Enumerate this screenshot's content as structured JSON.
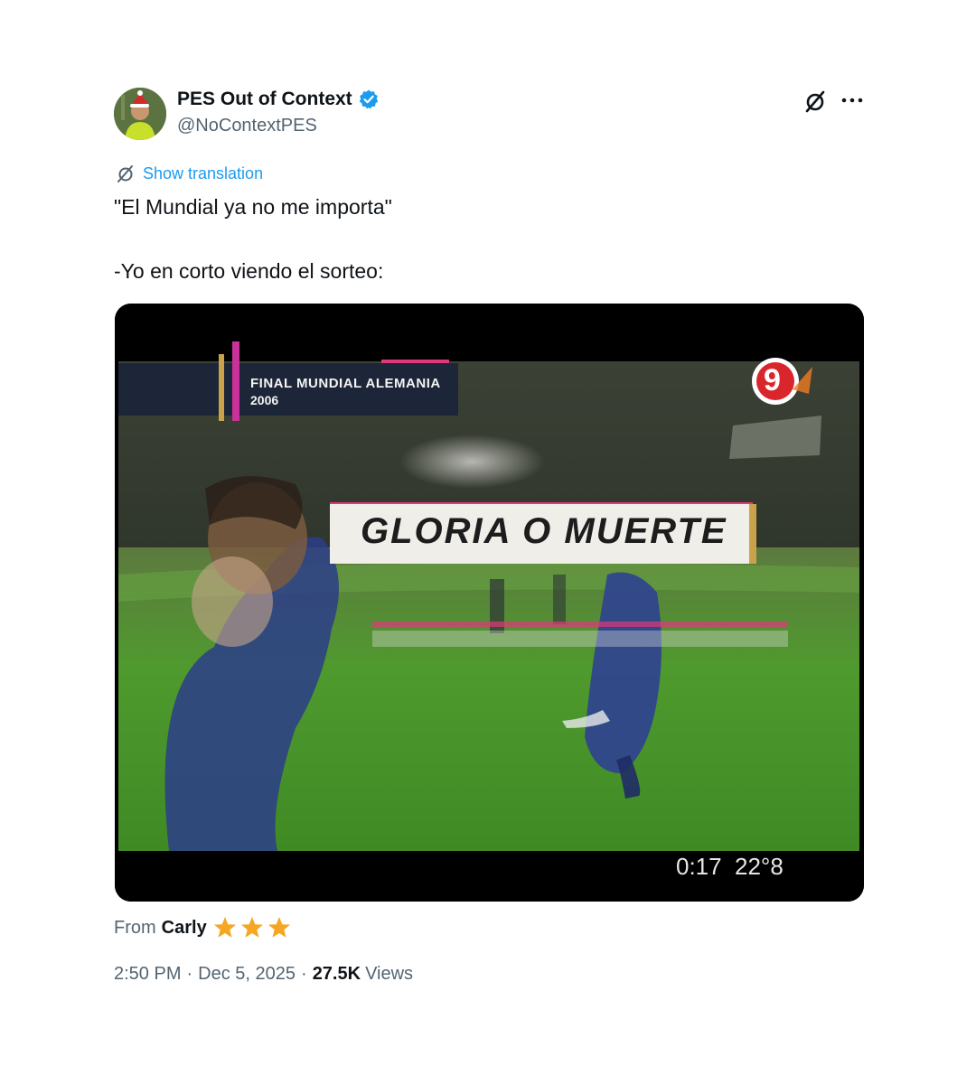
{
  "author": {
    "display_name": "PES Out of Context",
    "handle": "@NoContextPES",
    "verified_color": "#1d9bf0"
  },
  "header_icons": {
    "grok": "grok-icon",
    "more": "more-icon"
  },
  "translate": {
    "label": "Show translation",
    "color": "#1d9bf0"
  },
  "tweet": {
    "line1": "\"El Mundial ya no me importa\"",
    "line2": "-Yo en corto viendo el sorteo:"
  },
  "video": {
    "banner_title": "FINAL MUNDIAL ALEMANIA",
    "banner_year": "2006",
    "channel_number": "9",
    "caption": "GLORIA O MUERTE",
    "time_elapsed": "0:17",
    "time_total": "22°8"
  },
  "source": {
    "prefix": "From",
    "app": "Carly",
    "stars": 3,
    "star_color": "#f5a623"
  },
  "meta": {
    "time": "2:50 PM",
    "dot1": "·",
    "date": "Dec 5, 2025",
    "dot2": "·",
    "views": "27.5K",
    "views_label": "Views"
  }
}
